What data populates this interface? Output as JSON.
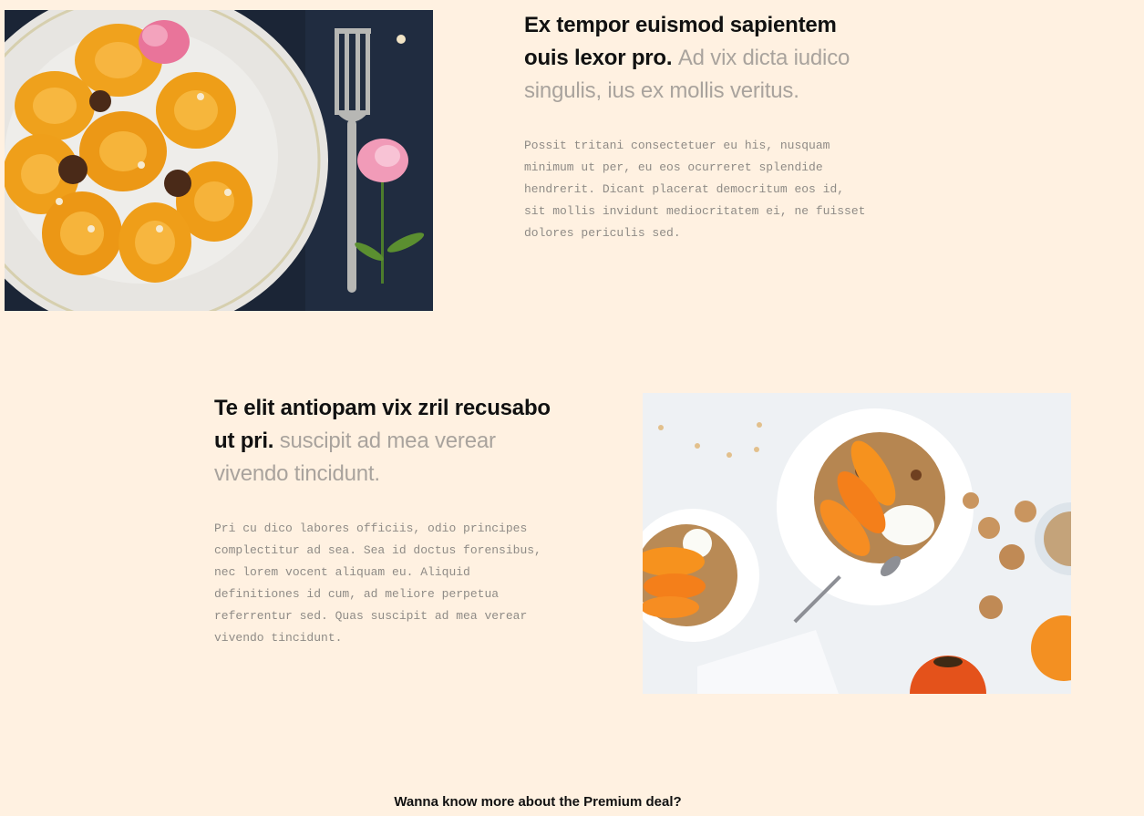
{
  "sections": [
    {
      "headline_bold": "Ex tempor euismod sapientem ouis lexor pro.",
      "headline_light": "Ad vix dicta iudico singulis, ius ex mollis veritus.",
      "body": "Possit tritani consectetuer eu his, nusquam minimum ut per, eu eos ocurreret splendide hendrerit. Dicant placerat democritum eos id, sit mollis invidunt mediocritatem ei, ne fuisset dolores periculis sed."
    },
    {
      "headline_bold": "Te elit antiopam vix zril recusabo ut pri.",
      "headline_light": "suscipit ad mea verear vivendo tincidunt.",
      "body": "Pri cu dico labores officiis, odio principes complectitur ad sea. Sea id doctus forensibus, nec lorem vocent aliquam eu. Aliquid definitiones id cum, ad meliore perpetua referrentur sed. Quas suscipit ad mea verear vivendo tincidunt."
    }
  ],
  "cta": {
    "premium_text": "Wanna know more about the Premium deal?"
  },
  "colors": {
    "background": "#fff1e1",
    "heading": "#111111",
    "heading_light": "#a9a39d",
    "body_text": "#8f8b86"
  }
}
